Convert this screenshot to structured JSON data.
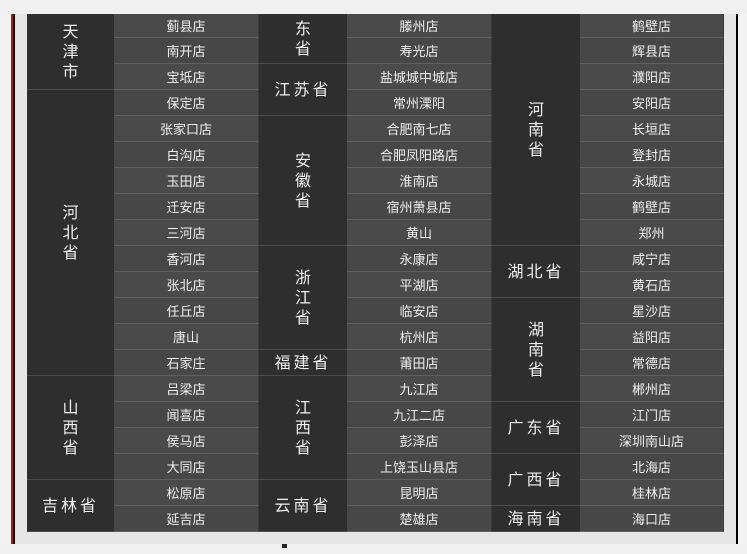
{
  "columns": [
    {
      "groups": [
        {
          "province": "天津市",
          "vertical": true,
          "stores": [
            "蓟县店",
            "南开店",
            "宝坻店"
          ]
        },
        {
          "province": "河北省",
          "vertical": true,
          "stores": [
            "保定店",
            "张家口店",
            "白沟店",
            "玉田店",
            "迁安店",
            "三河店",
            "香河店",
            "张北店",
            "任丘店",
            "唐山",
            "石家庄"
          ]
        },
        {
          "province": "山西省",
          "vertical": true,
          "stores": [
            "吕梁店",
            "闻喜店",
            "侯马店",
            "大同店"
          ]
        },
        {
          "province": "吉林省",
          "vertical": false,
          "stores": [
            "松原店",
            "延吉店"
          ]
        }
      ]
    },
    {
      "groups": [
        {
          "province": "东省",
          "vertical": true,
          "stores": [
            "滕州店",
            "寿光店"
          ]
        },
        {
          "province": "江苏省",
          "vertical": false,
          "stores": [
            "盐城城中城店",
            "常州溧阳"
          ]
        },
        {
          "province": "安徽省",
          "vertical": true,
          "stores": [
            "合肥南七店",
            "合肥凤阳路店",
            "淮南店",
            "宿州萧县店",
            "黄山"
          ]
        },
        {
          "province": "浙江省",
          "vertical": true,
          "stores": [
            "永康店",
            "平湖店",
            "临安店",
            "杭州店"
          ]
        },
        {
          "province": "福建省",
          "vertical": false,
          "stores": [
            "莆田店"
          ]
        },
        {
          "province": "江西省",
          "vertical": true,
          "stores": [
            "九江店",
            "九江二店",
            "彭泽店",
            "上饶玉山县店"
          ]
        },
        {
          "province": "云南省",
          "vertical": false,
          "stores": [
            "昆明店",
            "楚雄店"
          ]
        }
      ]
    },
    {
      "groups": [
        {
          "province": "河南省",
          "vertical": true,
          "stores": [
            "鹤壁店",
            "辉县店",
            "濮阳店",
            "安阳店",
            "长垣店",
            "登封店",
            "永城店",
            "鹤壁店",
            "郑州"
          ]
        },
        {
          "province": "湖北省",
          "vertical": false,
          "stores": [
            "咸宁店",
            "黄石店"
          ]
        },
        {
          "province": "湖南省",
          "vertical": true,
          "stores": [
            "星沙店",
            "益阳店",
            "常德店",
            "郴州店"
          ]
        },
        {
          "province": "广东省",
          "vertical": false,
          "stores": [
            "江门店",
            "深圳南山店"
          ]
        },
        {
          "province": "广西省",
          "vertical": false,
          "stores": [
            "北海店",
            "桂林店"
          ]
        },
        {
          "province": "海南省",
          "vertical": false,
          "stores": [
            "海口店"
          ]
        }
      ]
    }
  ]
}
